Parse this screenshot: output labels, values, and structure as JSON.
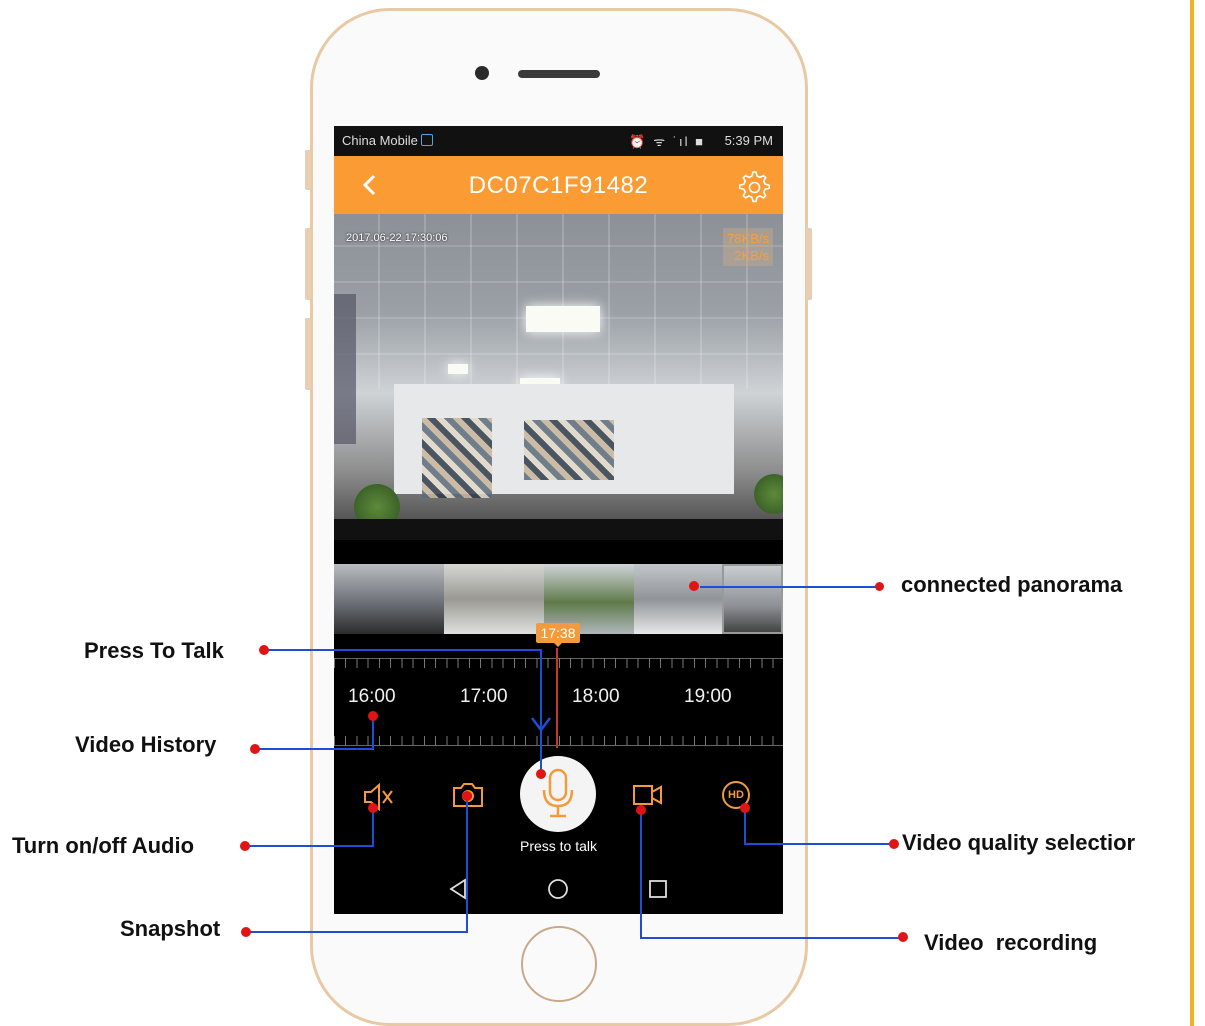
{
  "status_bar": {
    "carrier": "China Mobile",
    "icons": "⏰ ᯤ ˙ıl ■ ",
    "time": "5:39 PM"
  },
  "app_bar": {
    "title": "DC07C1F91482",
    "back_icon": "chevron-left-icon",
    "settings_icon": "gear-icon"
  },
  "video": {
    "timestamp": "2017.06-22 17:30:06",
    "download_rate": "78KB/s",
    "upload_rate": "2KB/s"
  },
  "timeline": {
    "current_time": "17:38",
    "hours": [
      "16:00",
      "17:00",
      "18:00",
      "19:00"
    ]
  },
  "controls": {
    "talk_label": "Press to talk",
    "hd_label": "HD"
  },
  "annotations": {
    "press_to_talk": "Press To Talk",
    "video_history": "Video History",
    "audio": "Turn on/off Audio",
    "snapshot": "Snapshot",
    "panorama": "connected panorama",
    "quality": "Video quality selectior",
    "recording": "Video  recording"
  },
  "colors": {
    "accent": "#fa9c33",
    "annotation_line": "#1f4ed6",
    "annotation_dot": "#e01414"
  }
}
